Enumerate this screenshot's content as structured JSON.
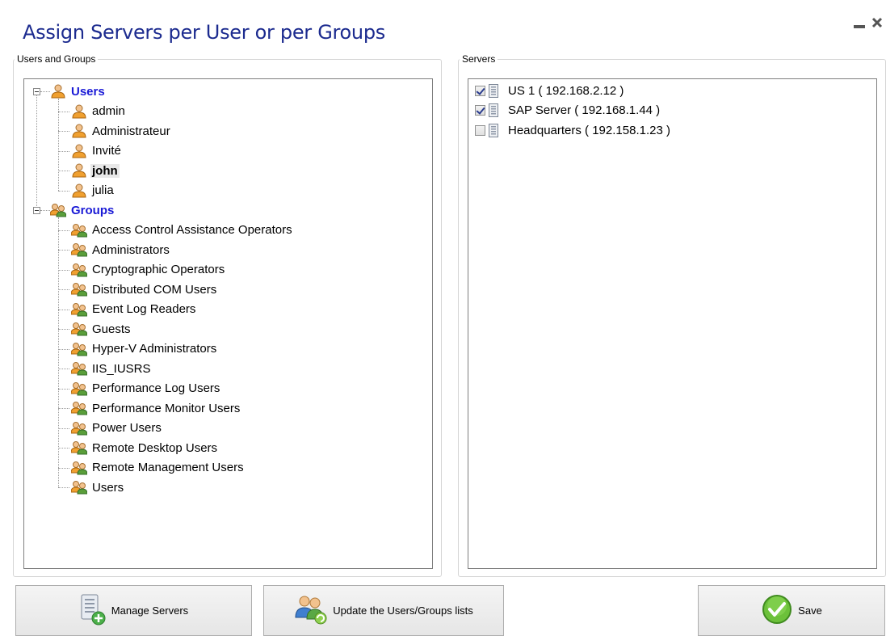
{
  "window": {
    "title": "Assign Servers per User or per Groups"
  },
  "users_group": {
    "legend": "Users and Groups",
    "users_root": "Users",
    "users": [
      "admin",
      "Administrateur",
      "Invité",
      "john",
      "julia"
    ],
    "selected_user": "john",
    "groups_root": "Groups",
    "groups": [
      "Access Control Assistance Operators",
      "Administrators",
      "Cryptographic Operators",
      "Distributed COM Users",
      "Event Log Readers",
      "Guests",
      "Hyper-V Administrators",
      "IIS_IUSRS",
      "Performance Log Users",
      "Performance Monitor Users",
      "Power Users",
      "Remote Desktop Users",
      "Remote Management Users",
      "Users"
    ]
  },
  "servers_group": {
    "legend": "Servers",
    "servers": [
      {
        "label": "US 1 ( 192.168.2.12 )",
        "checked": true
      },
      {
        "label": "SAP Server ( 192.168.1.44 )",
        "checked": true
      },
      {
        "label": "Headquarters ( 192.158.1.23 )",
        "checked": false
      }
    ]
  },
  "buttons": {
    "manage": "Manage Servers",
    "update": "Update the Users/Groups lists",
    "save": "Save"
  },
  "icons": {
    "user": "user-icon",
    "group": "group-icon",
    "server": "server-icon",
    "manage": "server-add-icon",
    "update": "users-refresh-icon",
    "save": "checkmark-icon"
  },
  "colors": {
    "title": "#1c2b8f",
    "root_node": "#1a1ad6",
    "save_green": "#5fb82b"
  }
}
